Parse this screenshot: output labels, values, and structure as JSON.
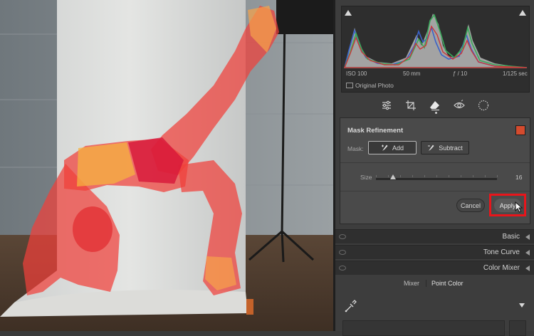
{
  "colors": {
    "mask_overlay": "#f0403a",
    "highlight_box": "#e8151b",
    "mask_swatch": "#d44b2e"
  },
  "histogram": {
    "exif": {
      "iso": "ISO 100",
      "focal": "50 mm",
      "aperture": "ƒ / 10",
      "shutter": "1/125 sec"
    },
    "original_photo_label": "Original Photo"
  },
  "tool_strip": {
    "icons": [
      "sliders-icon",
      "crop-icon",
      "eraser-icon",
      "red-eye-icon",
      "mask-circle-icon"
    ],
    "active": "eraser-icon"
  },
  "mask_refinement": {
    "title": "Mask Refinement",
    "mask_label": "Mask:",
    "add_label": "Add",
    "subtract_label": "Subtract",
    "mode": "Add",
    "size_label": "Size",
    "size_value": "16",
    "size_fraction": 0.14,
    "cancel_label": "Cancel",
    "apply_label": "Apply"
  },
  "sections": [
    {
      "title": "Basic"
    },
    {
      "title": "Tone Curve"
    },
    {
      "title": "Color Mixer"
    }
  ],
  "color_mixer": {
    "tab_mixer": "Mixer",
    "tab_point_color": "Point Color"
  }
}
